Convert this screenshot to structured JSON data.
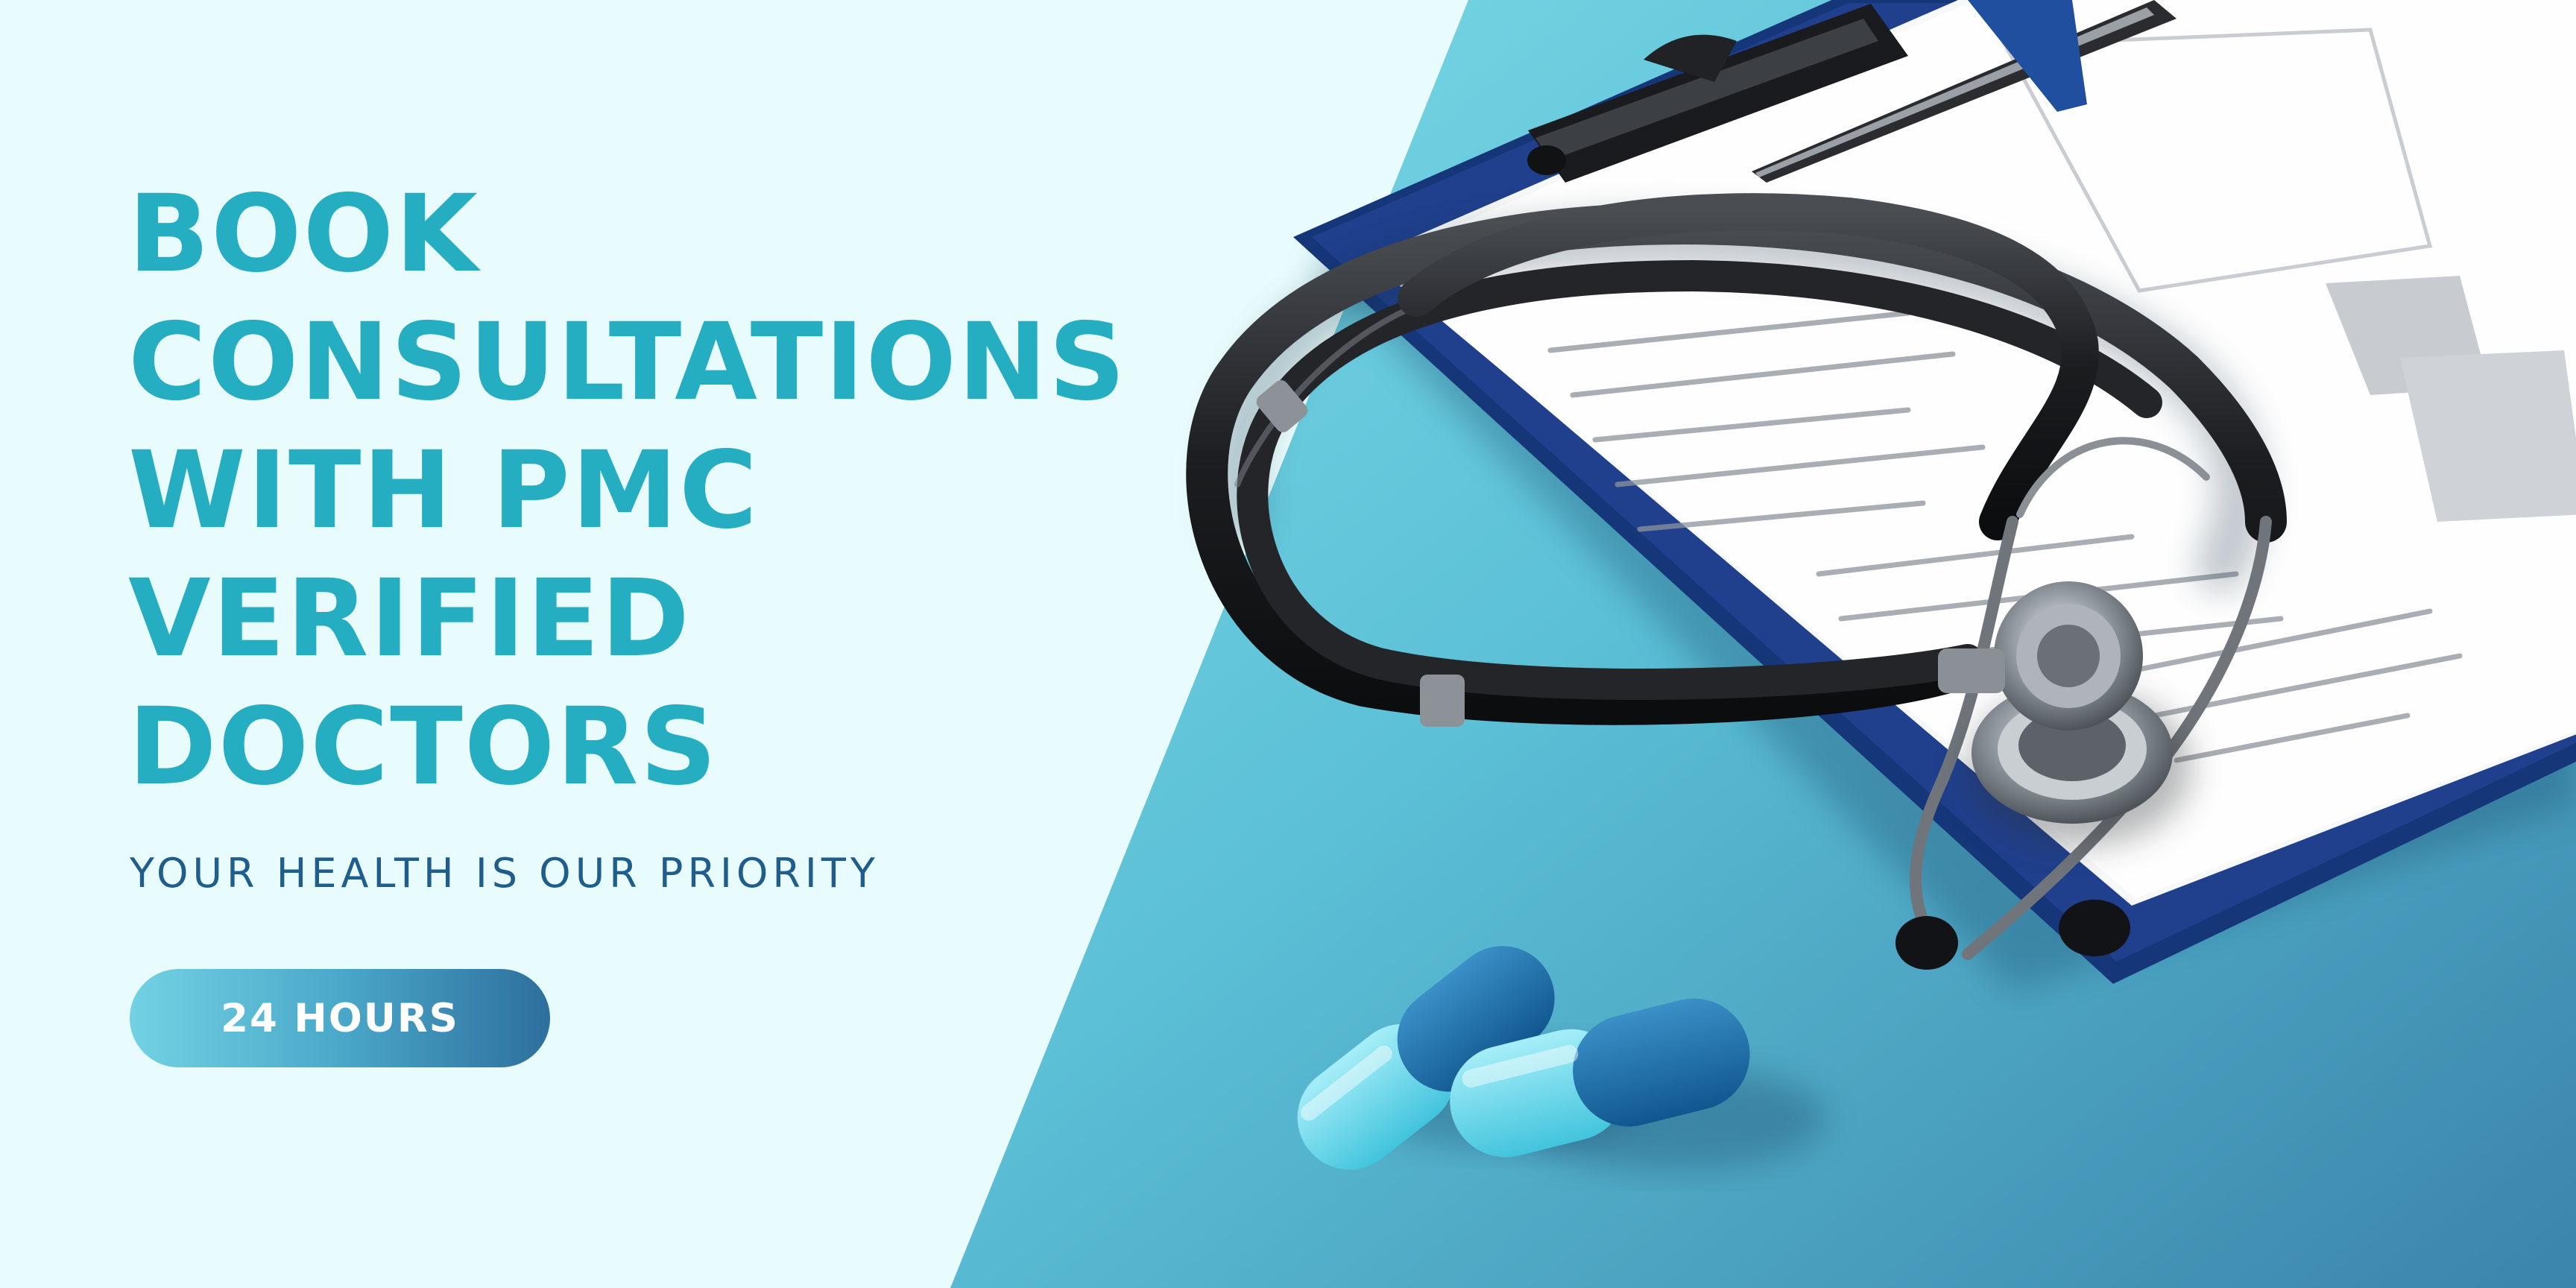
{
  "headline": {
    "lines": [
      "BOOK",
      "CONSULTATIONS",
      "WITH PMC",
      "VERIFIED",
      "DOCTORS"
    ]
  },
  "tagline": "YOUR HEALTH IS OUR PRIORITY",
  "cta": {
    "label": "24 HOURS"
  },
  "colors": {
    "background": "#e9fcfd",
    "headline": "#25adc2",
    "tagline": "#1f5d8c",
    "panel_start": "#7cdbe6",
    "panel_end": "#3b84aa"
  },
  "image": {
    "icons": [
      "stethoscope-icon",
      "clipboard-icon",
      "pen-icon",
      "capsule-icon"
    ]
  }
}
